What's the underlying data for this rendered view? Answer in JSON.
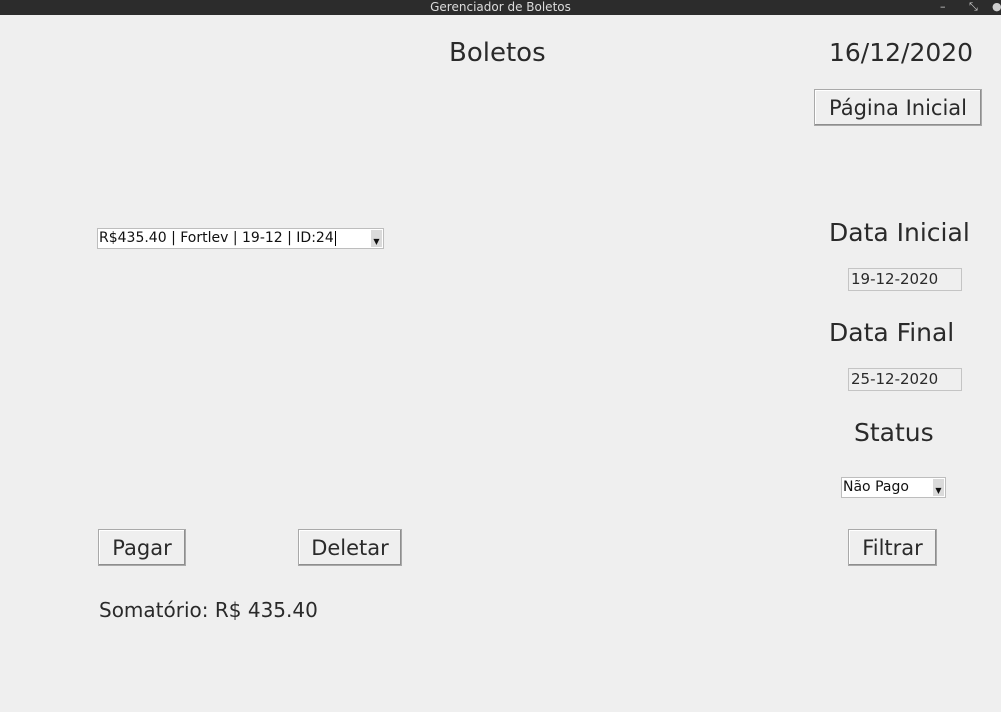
{
  "window": {
    "title": "Gerenciador de Boletos",
    "controls": [
      "–",
      "⤡",
      "●"
    ]
  },
  "header": {
    "title": "Boletos",
    "date": "16/12/2020",
    "home_button": "Página Inicial"
  },
  "boleto_select": {
    "value": "R$435.40 | Fortlev | 19-12 | ID:24"
  },
  "filters": {
    "start_label": "Data Inicial",
    "start_value": "19-12-2020",
    "end_label": "Data Final",
    "end_value": "25-12-2020",
    "status_label": "Status",
    "status_value": "Não Pago",
    "filter_button": "Filtrar"
  },
  "actions": {
    "pay_button": "Pagar",
    "delete_button": "Deletar"
  },
  "summary": {
    "text": "Somatório: R$ 435.40"
  }
}
